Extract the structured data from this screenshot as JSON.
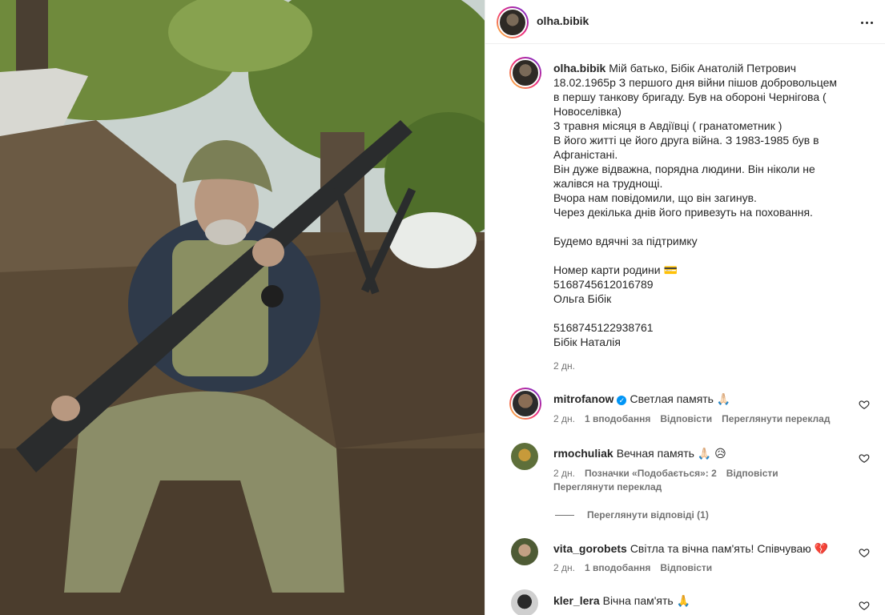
{
  "post": {
    "username": "olha.bibik",
    "caption_user": "olha.bibik",
    "caption_text": "Мій батько, Бібік Анатолій Петрович 18.02.1965р З першого дня війни пішов добровольцем в першу танкову бригаду. Був на обороні Чернігова ( Новоселівка)\nЗ травня місяця в Авдіївці ( гранатометник )\nВ його житті це його друга війна. З 1983-1985 був в Афганістані.\nВін дуже відважна, порядна людини. Він ніколи не жалівся на труднощі.\nВчора нам повідомили, що він загинув.\nЧерез декілька днів його привезуть на поховання.\n\nБудемо вдячні за підтримку\n\nНомер карти родини 💳\n5168745612016789\nОльга Бібік\n\n5168745122938761\nБібік Наталія",
    "caption_time": "2 дн."
  },
  "icons": {
    "more": "more-horizontal-icon",
    "heart": "heart-outline-icon",
    "verified": "verified-badge-icon"
  },
  "comments": [
    {
      "user": "mitrofanow",
      "verified": true,
      "text": "Светлая память 🙏🏻",
      "time": "2 дн.",
      "likes": "1 вподобання",
      "reply": "Відповісти",
      "translate": "Переглянути переклад"
    },
    {
      "user": "rmochuliak",
      "text": "Вечная память 🙏🏻 😥",
      "time": "2 дн.",
      "likes": "Позначки «Подобається»: 2",
      "reply": "Відповісти",
      "translate": "Переглянути переклад",
      "view_replies": "Переглянути відповіді (1)"
    },
    {
      "user": "vita_gorobets",
      "text": "Світла та вічна пам'ять! Співчуваю 💔",
      "time": "2 дн.",
      "likes": "1 вподобання",
      "reply": "Відповісти"
    },
    {
      "user": "kler_lera",
      "text": "Вічна пам'ять 🙏"
    }
  ],
  "colors": {
    "text": "#262626",
    "muted": "#737373",
    "verified": "#0095f6",
    "broken_heart": "#ed4956"
  }
}
